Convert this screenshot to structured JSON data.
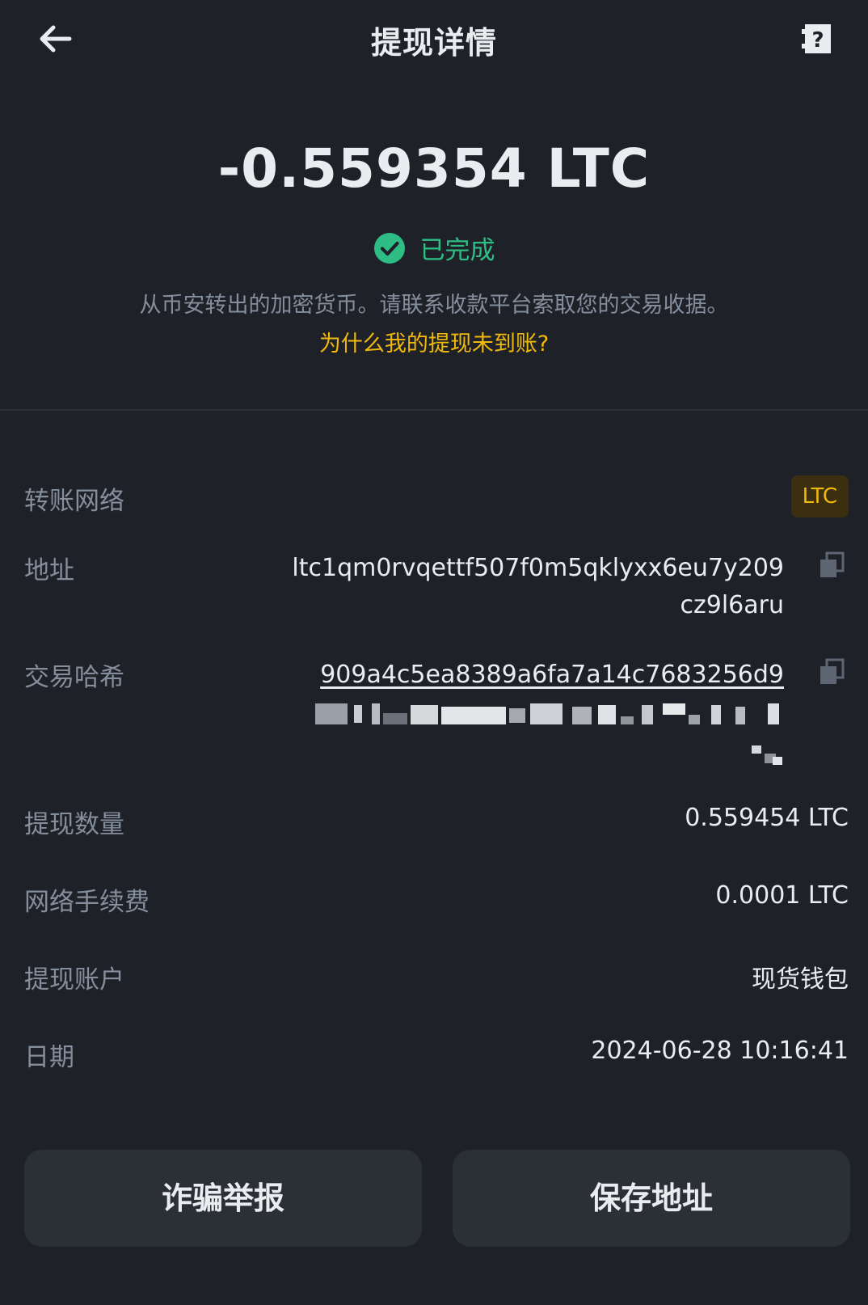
{
  "header": {
    "title": "提现详情"
  },
  "summary": {
    "amount": "-0.559354 LTC",
    "status": "已完成",
    "note": "从币安转出的加密货币。请联系收款平台索取您的交易收据。",
    "why_link": "为什么我的提现未到账?"
  },
  "details": {
    "network": {
      "label": "转账网络",
      "value": "LTC"
    },
    "address": {
      "label": "地址",
      "value": "ltc1qm0rvqettf507f0m5qklyxx6eu7y209cz9l6aru"
    },
    "txid": {
      "label": "交易哈希",
      "value": "909a4c5ea8389a6fa7a14c7683256d9"
    },
    "amount": {
      "label": "提现数量",
      "value": "0.559454 LTC"
    },
    "fee": {
      "label": "网络手续费",
      "value": "0.0001 LTC"
    },
    "account": {
      "label": "提现账户",
      "value": "现货钱包"
    },
    "date": {
      "label": "日期",
      "value": "2024-06-28 10:16:41"
    }
  },
  "actions": {
    "report_label": "诈骗举报",
    "save_label": "保存地址"
  },
  "icons": {
    "back": "arrow-left-icon",
    "help": "help-doc-icon",
    "status": "check-circle-icon",
    "copy": "copy-icon"
  },
  "colors": {
    "background": "#1f2129",
    "success": "#2ebd85",
    "accent": "#f0b90b",
    "muted": "#848e9c",
    "text": "#eaecef",
    "button": "#2b2f36"
  }
}
